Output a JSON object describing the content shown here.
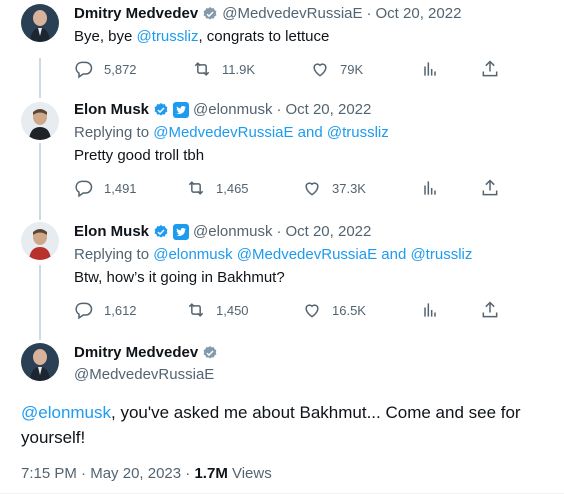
{
  "colors": {
    "accent": "#1d9bf0",
    "muted": "#536471",
    "text": "#0f1419",
    "thread": "#cfd9de"
  },
  "tweets": [
    {
      "name": "Dmitry Medvedev",
      "badge": "grey-verified-icon",
      "handle": "@MedvedevRussiaE",
      "dot": "·",
      "date": "Oct 20, 2022",
      "text_prefix": "Bye, bye ",
      "text_mention": "@trussliz",
      "text_suffix": ", congrats to lettuce",
      "replies": "5,872",
      "retweets": "11.9K",
      "likes": "79K"
    },
    {
      "name": "Elon Musk",
      "handle": "@elonmusk",
      "dot": "·",
      "date": "Oct 20, 2022",
      "replying_label": "Replying to ",
      "replying_to": "@MedvedevRussiaE and @trussliz",
      "text": "Pretty good troll tbh",
      "replies": "1,491",
      "retweets": "1,465",
      "likes": "37.3K"
    },
    {
      "name": "Elon Musk",
      "handle": "@elonmusk",
      "dot": "·",
      "date": "Oct 20, 2022",
      "replying_label": "Replying to ",
      "replying_to": "@elonmusk @MedvedevRussiaE and @trussliz",
      "text": "Btw, how’s it going in Bakhmut?",
      "replies": "1,612",
      "retweets": "1,450",
      "likes": "16.5K"
    }
  ],
  "main": {
    "name": "Dmitry Medvedev",
    "handle": "@MedvedevRussiaE",
    "text_mention": "@elonmusk",
    "text_body": ", you've asked me about Bakhmut... Come and see for yourself!",
    "time": "7:15 PM",
    "dot": "·",
    "date": "May 20, 2023",
    "dot2": "·",
    "views_count": "1.7M",
    "views_label": " Views"
  }
}
